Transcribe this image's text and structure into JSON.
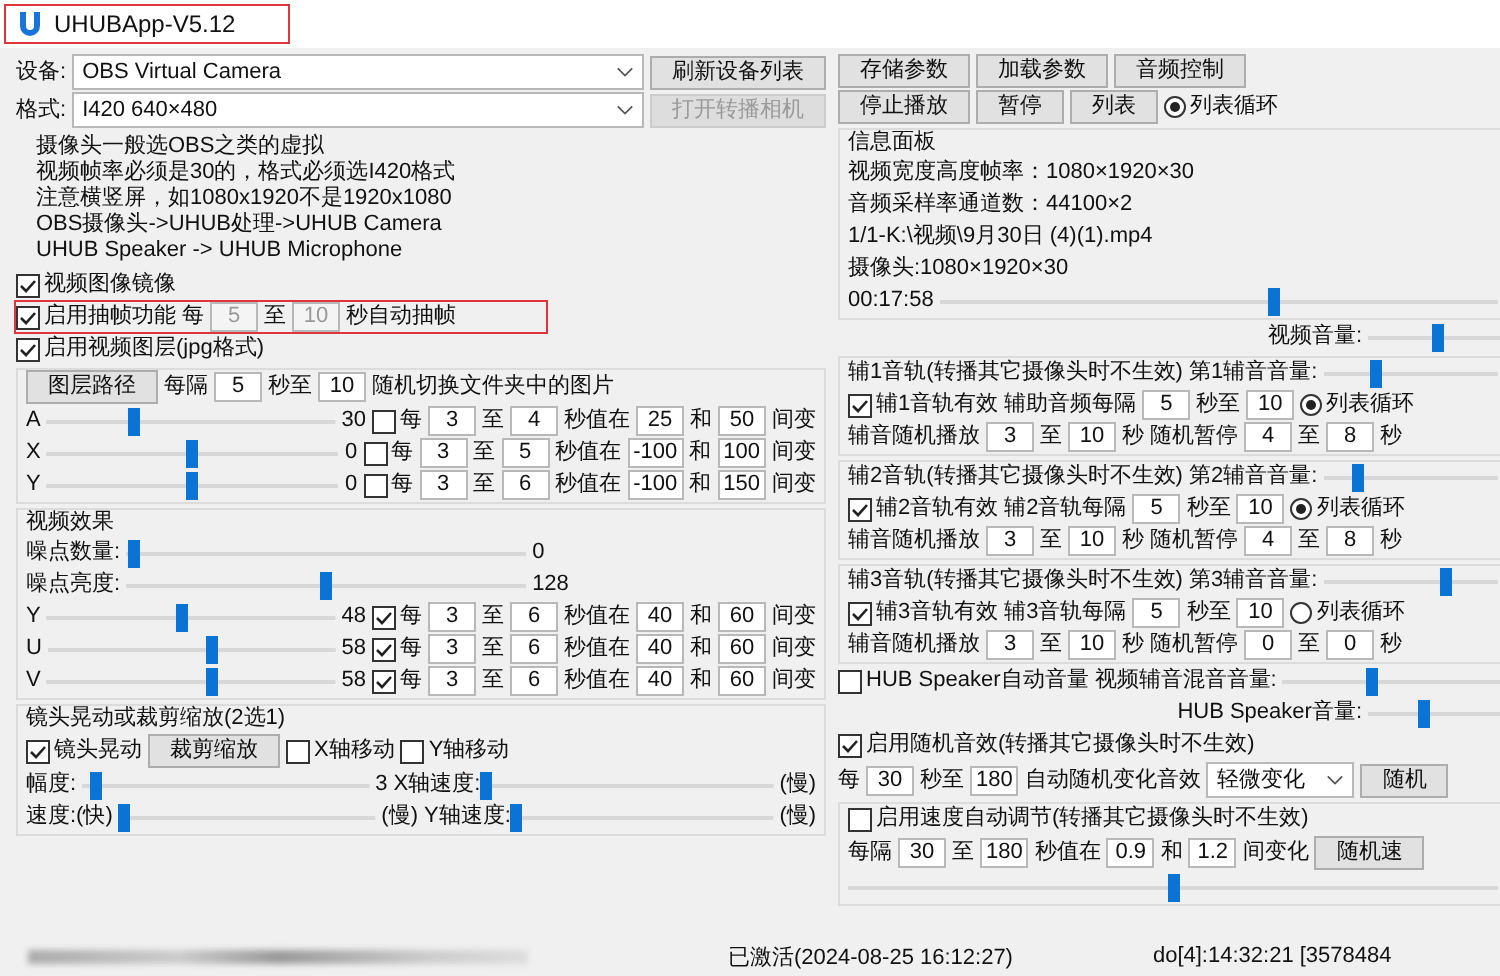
{
  "window": {
    "title": "UHUBApp-V5.12",
    "highlighted": true
  },
  "left": [
    {
      "kind": "rows",
      "rows": [
        {
          "kind": "normal",
          "parts": [
            {
              "kind": "text",
              "text": "设备:"
            },
            {
              "kind": "select",
              "value": "OBS Virtual Camera"
            },
            {
              "kind": "button",
              "label": "刷新设备列表",
              "disabled": false
            }
          ]
        },
        {
          "kind": "normal",
          "parts": [
            {
              "kind": "text",
              "text": "格式:"
            },
            {
              "kind": "select",
              "value": "I420 640×480"
            },
            {
              "kind": "button",
              "label": "打开转播相机",
              "disabled": true
            }
          ]
        }
      ]
    },
    {
      "kind": "notes",
      "lines": [
        "摄像头一般选OBS之类的虚拟",
        "视频帧率必须是30的，格式必须选I420格式",
        "注意横竖屏，如1080x1920不是1920x1080",
        "OBS摄像头->UHUB处理->UHUB Camera",
        "UHUB Speaker -> UHUB Microphone"
      ]
    },
    {
      "kind": "rows",
      "rows": [
        {
          "kind": "normal",
          "parts": [
            {
              "kind": "check",
              "label": "视频图像镜像",
              "checked": true
            }
          ]
        },
        {
          "kind": "normal",
          "highlighted": true,
          "parts": [
            {
              "kind": "check",
              "label": "启用抽帧功能",
              "checked": true
            },
            {
              "kind": "text",
              "text": "每"
            },
            {
              "kind": "field",
              "value": "5",
              "disabled": true
            },
            {
              "kind": "text",
              "text": "至"
            },
            {
              "kind": "field",
              "value": "10",
              "disabled": true
            },
            {
              "kind": "text",
              "text": "秒自动抽帧"
            }
          ]
        },
        {
          "kind": "normal",
          "parts": [
            {
              "kind": "check",
              "label": "启用视频图层(jpg格式)",
              "checked": true
            }
          ]
        }
      ]
    },
    {
      "kind": "group",
      "rows": [
        {
          "kind": "normal",
          "parts": [
            {
              "kind": "button",
              "label": "图层路径",
              "disabled": false
            },
            {
              "kind": "text",
              "text": "每隔"
            },
            {
              "kind": "field",
              "value": "5"
            },
            {
              "kind": "text",
              "text": "秒至"
            },
            {
              "kind": "field",
              "value": "10"
            },
            {
              "kind": "text",
              "text": "随机切换文件夹中的图片"
            }
          ]
        },
        {
          "kind": "normal",
          "parts": [
            {
              "kind": "text",
              "text": "A"
            },
            {
              "kind": "slider",
              "level": 0.3
            },
            {
              "kind": "text",
              "text": "30"
            },
            {
              "kind": "check",
              "label": "每",
              "checked": false
            },
            {
              "kind": "field",
              "value": "3"
            },
            {
              "kind": "text",
              "text": "至"
            },
            {
              "kind": "field",
              "value": "4"
            },
            {
              "kind": "text",
              "text": "秒值在"
            },
            {
              "kind": "field",
              "value": "25"
            },
            {
              "kind": "text",
              "text": "和"
            },
            {
              "kind": "field",
              "value": "50"
            },
            {
              "kind": "text",
              "text": "间变"
            }
          ]
        },
        {
          "kind": "normal",
          "parts": [
            {
              "kind": "text",
              "text": "X"
            },
            {
              "kind": "slider",
              "level": 0.5
            },
            {
              "kind": "text",
              "text": "0"
            },
            {
              "kind": "check",
              "label": "每",
              "checked": false
            },
            {
              "kind": "field",
              "value": "3"
            },
            {
              "kind": "text",
              "text": "至"
            },
            {
              "kind": "field",
              "value": "5"
            },
            {
              "kind": "text",
              "text": "秒值在"
            },
            {
              "kind": "field",
              "value": "-100"
            },
            {
              "kind": "text",
              "text": "和"
            },
            {
              "kind": "field",
              "value": "100"
            },
            {
              "kind": "text",
              "text": "间变"
            }
          ]
        },
        {
          "kind": "normal",
          "parts": [
            {
              "kind": "text",
              "text": "Y"
            },
            {
              "kind": "slider",
              "level": 0.5
            },
            {
              "kind": "text",
              "text": "0"
            },
            {
              "kind": "check",
              "label": "每",
              "checked": false
            },
            {
              "kind": "field",
              "value": "3"
            },
            {
              "kind": "text",
              "text": "至"
            },
            {
              "kind": "field",
              "value": "6"
            },
            {
              "kind": "text",
              "text": "秒值在"
            },
            {
              "kind": "field",
              "value": "-100"
            },
            {
              "kind": "text",
              "text": "和"
            },
            {
              "kind": "field",
              "value": "150"
            },
            {
              "kind": "text",
              "text": "间变"
            }
          ]
        }
      ]
    },
    {
      "kind": "group",
      "title": "视频效果",
      "rows": [
        {
          "kind": "normal",
          "parts": [
            {
              "kind": "text",
              "text": "噪点数量:"
            },
            {
              "kind": "slider",
              "level": 0.02
            },
            {
              "kind": "text",
              "text": "0"
            }
          ]
        },
        {
          "kind": "normal",
          "parts": [
            {
              "kind": "text",
              "text": "噪点亮度:"
            },
            {
              "kind": "slider",
              "level": 0.5
            },
            {
              "kind": "text",
              "text": "128"
            }
          ]
        },
        {
          "kind": "normal",
          "parts": [
            {
              "kind": "text",
              "text": "Y"
            },
            {
              "kind": "slider",
              "level": 0.47
            },
            {
              "kind": "text",
              "text": "48"
            },
            {
              "kind": "check",
              "label": "每",
              "checked": true
            },
            {
              "kind": "field",
              "value": "3"
            },
            {
              "kind": "text",
              "text": "至"
            },
            {
              "kind": "field",
              "value": "6"
            },
            {
              "kind": "text",
              "text": "秒值在"
            },
            {
              "kind": "field",
              "value": "40"
            },
            {
              "kind": "text",
              "text": "和"
            },
            {
              "kind": "field",
              "value": "60"
            },
            {
              "kind": "text",
              "text": "间变"
            }
          ]
        },
        {
          "kind": "normal",
          "parts": [
            {
              "kind": "text",
              "text": "U"
            },
            {
              "kind": "slider",
              "level": 0.57
            },
            {
              "kind": "text",
              "text": "58"
            },
            {
              "kind": "check",
              "label": "每",
              "checked": true
            },
            {
              "kind": "field",
              "value": "3"
            },
            {
              "kind": "text",
              "text": "至"
            },
            {
              "kind": "field",
              "value": "6"
            },
            {
              "kind": "text",
              "text": "秒值在"
            },
            {
              "kind": "field",
              "value": "40"
            },
            {
              "kind": "text",
              "text": "和"
            },
            {
              "kind": "field",
              "value": "60"
            },
            {
              "kind": "text",
              "text": "间变"
            }
          ]
        },
        {
          "kind": "normal",
          "parts": [
            {
              "kind": "text",
              "text": "V"
            },
            {
              "kind": "slider",
              "level": 0.57
            },
            {
              "kind": "text",
              "text": "58"
            },
            {
              "kind": "check",
              "label": "每",
              "checked": true
            },
            {
              "kind": "field",
              "value": "3"
            },
            {
              "kind": "text",
              "text": "至"
            },
            {
              "kind": "field",
              "value": "6"
            },
            {
              "kind": "text",
              "text": "秒值在"
            },
            {
              "kind": "field",
              "value": "40"
            },
            {
              "kind": "text",
              "text": "和"
            },
            {
              "kind": "field",
              "value": "60"
            },
            {
              "kind": "text",
              "text": "间变"
            }
          ]
        }
      ]
    },
    {
      "kind": "group",
      "title": "镜头晃动或裁剪缩放(2选1)",
      "rows": [
        {
          "kind": "normal",
          "parts": [
            {
              "kind": "check",
              "label": "镜头晃动",
              "checked": true
            },
            {
              "kind": "button",
              "label": "裁剪缩放",
              "disabled": false
            },
            {
              "kind": "check",
              "label": "X轴移动",
              "checked": false
            },
            {
              "kind": "check",
              "label": "Y轴移动",
              "checked": false
            }
          ]
        },
        {
          "kind": "normal",
          "parts": [
            {
              "kind": "text",
              "text": "幅度:"
            },
            {
              "kind": "slider",
              "level": 0.05
            },
            {
              "kind": "text",
              "text": "3"
            },
            {
              "kind": "text",
              "text": "X轴速度:"
            },
            {
              "kind": "slider",
              "level": 0.0
            },
            {
              "kind": "text",
              "text": "(慢)"
            }
          ]
        },
        {
          "kind": "normal",
          "parts": [
            {
              "kind": "text",
              "text": "速度:(快)"
            },
            {
              "kind": "slider",
              "level": 0.02
            },
            {
              "kind": "text",
              "text": "(慢)"
            },
            {
              "kind": "text",
              "text": "Y轴速度:"
            },
            {
              "kind": "slider",
              "level": 0.0
            },
            {
              "kind": "text",
              "text": "(慢)"
            }
          ]
        }
      ]
    }
  ],
  "right": [
    {
      "kind": "rows",
      "rows": [
        {
          "kind": "normal",
          "parts": [
            {
              "kind": "button",
              "label": "存储参数",
              "disabled": false
            },
            {
              "kind": "button",
              "label": "加载参数",
              "disabled": false
            },
            {
              "kind": "button",
              "label": "音频控制",
              "disabled": false
            }
          ]
        },
        {
          "kind": "normal",
          "parts": [
            {
              "kind": "button",
              "label": "停止播放",
              "disabled": false
            },
            {
              "kind": "button",
              "label": "暂停",
              "disabled": false
            },
            {
              "kind": "button",
              "label": "列表",
              "disabled": false
            },
            {
              "kind": "radio",
              "label": "列表循环",
              "selected": true
            }
          ]
        }
      ]
    },
    {
      "kind": "group",
      "title": "信息面板",
      "rows": [
        {
          "kind": "normal",
          "parts": [
            {
              "kind": "text",
              "text": "视频宽度高度帧率：1080×1920×30"
            }
          ]
        },
        {
          "kind": "normal",
          "parts": [
            {
              "kind": "text",
              "text": "音频采样率通道数：44100×2"
            }
          ]
        },
        {
          "kind": "normal",
          "parts": [
            {
              "kind": "text",
              "text": "1/1-K:\\视频\\9月30日 (4)(1).mp4"
            }
          ]
        },
        {
          "kind": "normal",
          "parts": [
            {
              "kind": "text",
              "text": "摄像头:1080×1920×30"
            }
          ]
        },
        {
          "kind": "normal",
          "parts": [
            {
              "kind": "text",
              "text": "00:17:58"
            },
            {
              "kind": "slider",
              "level": 0.6
            }
          ]
        }
      ]
    },
    {
      "kind": "rows",
      "rows": [
        {
          "kind": "trailing",
          "parts": [
            {
              "kind": "text",
              "text": "视频音量:"
            },
            {
              "kind": "slider",
              "level": 0.5
            }
          ]
        }
      ]
    },
    {
      "kind": "group",
      "rows": [
        {
          "kind": "normal",
          "parts": [
            {
              "kind": "text",
              "text": "辅1音轨(转播其它摄像头时不生效)"
            },
            {
              "kind": "text",
              "text": "第1辅音音量:"
            },
            {
              "kind": "slider",
              "level": 0.3
            }
          ]
        },
        {
          "kind": "normal",
          "parts": [
            {
              "kind": "check",
              "label": "辅1音轨有效",
              "checked": true
            },
            {
              "kind": "text",
              "text": "辅助音频每隔"
            },
            {
              "kind": "field",
              "value": "5"
            },
            {
              "kind": "text",
              "text": "秒至"
            },
            {
              "kind": "field",
              "value": "10"
            },
            {
              "kind": "radio",
              "label": "列表循环",
              "selected": true
            }
          ]
        },
        {
          "kind": "normal",
          "parts": [
            {
              "kind": "text",
              "text": "辅音随机播放"
            },
            {
              "kind": "field",
              "value": "3"
            },
            {
              "kind": "text",
              "text": "至"
            },
            {
              "kind": "field",
              "value": "10"
            },
            {
              "kind": "text",
              "text": "秒 随机暂停"
            },
            {
              "kind": "field",
              "value": "4"
            },
            {
              "kind": "text",
              "text": "至"
            },
            {
              "kind": "field",
              "value": "8"
            },
            {
              "kind": "text",
              "text": "秒"
            }
          ]
        }
      ]
    },
    {
      "kind": "group",
      "rows": [
        {
          "kind": "normal",
          "parts": [
            {
              "kind": "text",
              "text": "辅2音轨(转播其它摄像头时不生效)"
            },
            {
              "kind": "text",
              "text": "第2辅音音量:"
            },
            {
              "kind": "slider",
              "level": 0.2
            }
          ]
        },
        {
          "kind": "normal",
          "parts": [
            {
              "kind": "check",
              "label": "辅2音轨有效",
              "checked": true
            },
            {
              "kind": "text",
              "text": "辅2音轨每隔"
            },
            {
              "kind": "field",
              "value": "5"
            },
            {
              "kind": "text",
              "text": "秒至"
            },
            {
              "kind": "field",
              "value": "10"
            },
            {
              "kind": "radio",
              "label": "列表循环",
              "selected": true
            }
          ]
        },
        {
          "kind": "normal",
          "parts": [
            {
              "kind": "text",
              "text": "辅音随机播放"
            },
            {
              "kind": "field",
              "value": "3"
            },
            {
              "kind": "text",
              "text": "至"
            },
            {
              "kind": "field",
              "value": "10"
            },
            {
              "kind": "text",
              "text": "秒 随机暂停"
            },
            {
              "kind": "field",
              "value": "4"
            },
            {
              "kind": "text",
              "text": "至"
            },
            {
              "kind": "field",
              "value": "8"
            },
            {
              "kind": "text",
              "text": "秒"
            }
          ]
        }
      ]
    },
    {
      "kind": "group",
      "rows": [
        {
          "kind": "normal",
          "parts": [
            {
              "kind": "text",
              "text": "辅3音轨(转播其它摄像头时不生效)"
            },
            {
              "kind": "text",
              "text": "第3辅音音量:"
            },
            {
              "kind": "slider",
              "level": 0.7
            }
          ]
        },
        {
          "kind": "normal",
          "parts": [
            {
              "kind": "check",
              "label": "辅3音轨有效",
              "checked": true
            },
            {
              "kind": "text",
              "text": "辅3音轨每隔"
            },
            {
              "kind": "field",
              "value": "5"
            },
            {
              "kind": "text",
              "text": "秒至"
            },
            {
              "kind": "field",
              "value": "10"
            },
            {
              "kind": "radio",
              "label": "列表循环",
              "selected": false
            }
          ]
        },
        {
          "kind": "normal",
          "parts": [
            {
              "kind": "text",
              "text": "辅音随机播放"
            },
            {
              "kind": "field",
              "value": "3"
            },
            {
              "kind": "text",
              "text": "至"
            },
            {
              "kind": "field",
              "value": "10"
            },
            {
              "kind": "text",
              "text": "秒 随机暂停"
            },
            {
              "kind": "field",
              "value": "0"
            },
            {
              "kind": "text",
              "text": "至"
            },
            {
              "kind": "field",
              "value": "0"
            },
            {
              "kind": "text",
              "text": "秒"
            }
          ]
        }
      ]
    },
    {
      "kind": "rows",
      "rows": [
        {
          "kind": "normal",
          "parts": [
            {
              "kind": "check",
              "label": "HUB Speaker自动音量",
              "checked": false
            },
            {
              "kind": "text",
              "text": "视频辅音混音音量:"
            },
            {
              "kind": "slider",
              "level": 0.4
            }
          ]
        },
        {
          "kind": "trailing",
          "parts": [
            {
              "kind": "text",
              "text": "HUB Speaker音量:"
            },
            {
              "kind": "slider",
              "level": 0.4
            }
          ]
        },
        {
          "kind": "normal",
          "parts": [
            {
              "kind": "check",
              "label": "启用随机音效(转播其它摄像头时不生效)",
              "checked": true
            }
          ]
        },
        {
          "kind": "normal",
          "parts": [
            {
              "kind": "text",
              "text": "每"
            },
            {
              "kind": "field",
              "value": "30"
            },
            {
              "kind": "text",
              "text": "秒至"
            },
            {
              "kind": "field",
              "value": "180"
            },
            {
              "kind": "text",
              "text": "自动随机变化音效"
            },
            {
              "kind": "select",
              "value": "轻微变化"
            },
            {
              "kind": "button",
              "label": "随机",
              "disabled": false
            }
          ]
        }
      ]
    },
    {
      "kind": "group",
      "rows": [
        {
          "kind": "normal",
          "parts": [
            {
              "kind": "check",
              "label": "启用速度自动调节(转播其它摄像头时不生效)",
              "checked": false
            }
          ]
        },
        {
          "kind": "normal",
          "parts": [
            {
              "kind": "text",
              "text": "每隔"
            },
            {
              "kind": "field",
              "value": "30"
            },
            {
              "kind": "text",
              "text": "至"
            },
            {
              "kind": "field",
              "value": "180"
            },
            {
              "kind": "text",
              "text": "秒值在"
            },
            {
              "kind": "field",
              "value": "0.9"
            },
            {
              "kind": "text",
              "text": "和"
            },
            {
              "kind": "field",
              "value": "1.2"
            },
            {
              "kind": "text",
              "text": "间变化"
            },
            {
              "kind": "button",
              "label": "随机速",
              "disabled": false
            }
          ]
        },
        {
          "kind": "normal",
          "parts": [
            {
              "kind": "slider",
              "level": 0.5
            }
          ]
        }
      ]
    }
  ],
  "status": {
    "activated": "已激活(2024-08-25 16:12:27)",
    "clock": "do[4]:14:32:21 [3578484"
  }
}
